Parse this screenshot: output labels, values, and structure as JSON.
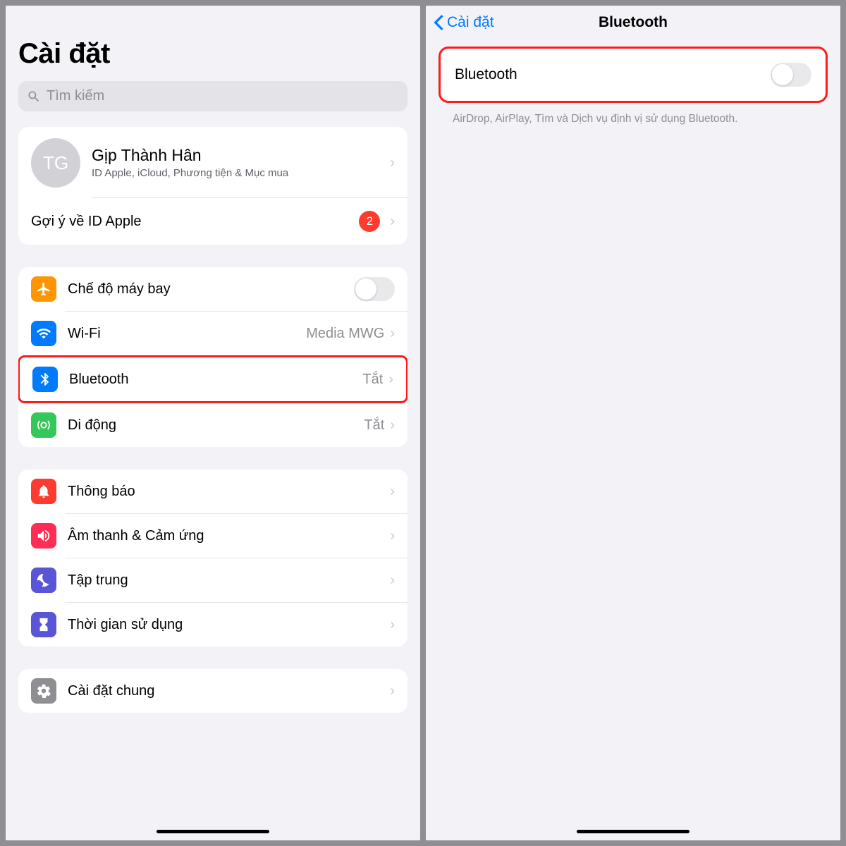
{
  "left": {
    "title": "Cài đặt",
    "search_placeholder": "Tìm kiếm",
    "profile": {
      "initials": "TG",
      "name": "Gịp Thành Hân",
      "subtitle": "ID Apple, iCloud, Phương tiện & Mục mua"
    },
    "apple_id_suggest": {
      "label": "Gợi ý về ID Apple",
      "badge": "2"
    },
    "network": {
      "airplane": "Chế độ máy bay",
      "wifi": {
        "label": "Wi-Fi",
        "value": "Media MWG"
      },
      "bluetooth": {
        "label": "Bluetooth",
        "value": "Tắt"
      },
      "cellular": {
        "label": "Di động",
        "value": "Tắt"
      }
    },
    "section2": {
      "notifications": "Thông báo",
      "sounds": "Âm thanh & Cảm ứng",
      "focus": "Tập trung",
      "screentime": "Thời gian sử dụng"
    },
    "section3": {
      "general": "Cài đặt chung"
    }
  },
  "right": {
    "back_label": "Cài đặt",
    "nav_title": "Bluetooth",
    "toggle_label": "Bluetooth",
    "footer": "AirDrop, AirPlay, Tìm và Dịch vụ định vị sử dụng Bluetooth."
  }
}
